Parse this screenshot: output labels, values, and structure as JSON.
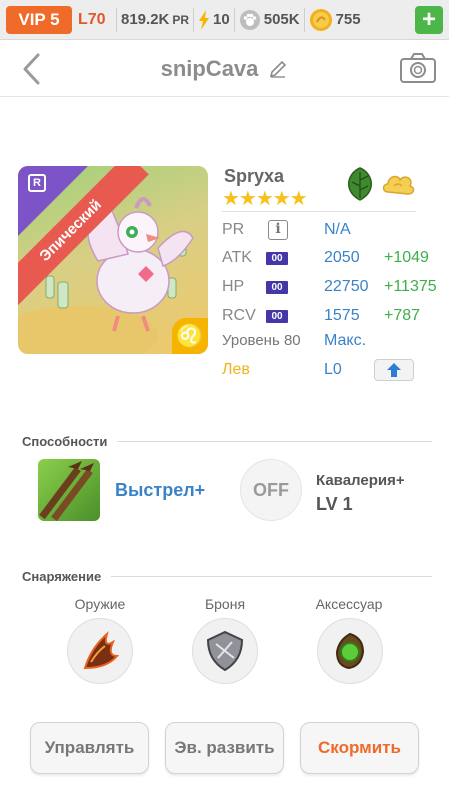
{
  "status_bar": {
    "vip": "VIP 5",
    "level": "L70",
    "pr_value": "819.2K",
    "pr_unit": "PR",
    "energy": "10",
    "paw": "505K",
    "coins": "755",
    "plus_label": "+"
  },
  "header": {
    "title": "snipCava"
  },
  "pet": {
    "rarity_label": "Эпический",
    "rarity_badge": "R",
    "name": "Spryxa",
    "star_count": 5,
    "stars": "★★★★★",
    "zodiac_symbol": "♌",
    "stats": [
      {
        "key": "PR",
        "value": "N/A",
        "bonus": ""
      },
      {
        "key": "ATK",
        "badge": "00",
        "value": "2050",
        "bonus": "+1049"
      },
      {
        "key": "HP",
        "badge": "00",
        "value": "22750",
        "bonus": "+11375"
      },
      {
        "key": "RCV",
        "badge": "00",
        "value": "1575",
        "bonus": "+787"
      }
    ],
    "level_label": "Уровень 80",
    "level_status": "Макс.",
    "sign_label": "Лев",
    "sign_level": "L0",
    "info_icon_label": "i"
  },
  "abilities": {
    "heading": "Способности",
    "primary": {
      "name": "Выстрел+"
    },
    "secondary": {
      "state": "OFF",
      "name": "Кавалерия+",
      "level": "LV 1"
    }
  },
  "equipment": {
    "heading": "Снаряжение",
    "slots": [
      {
        "label": "Оружие"
      },
      {
        "label": "Броня"
      },
      {
        "label": "Аксессуар"
      }
    ]
  },
  "buttons": {
    "manage": "Управлять",
    "evolve": "Эв. развить",
    "feed": "Скормить"
  },
  "colors": {
    "accent": "#f06a2a",
    "link": "#3a83c9",
    "bonus": "#3faf4a",
    "rarity": "#e85a4f",
    "add": "#4cb748"
  }
}
